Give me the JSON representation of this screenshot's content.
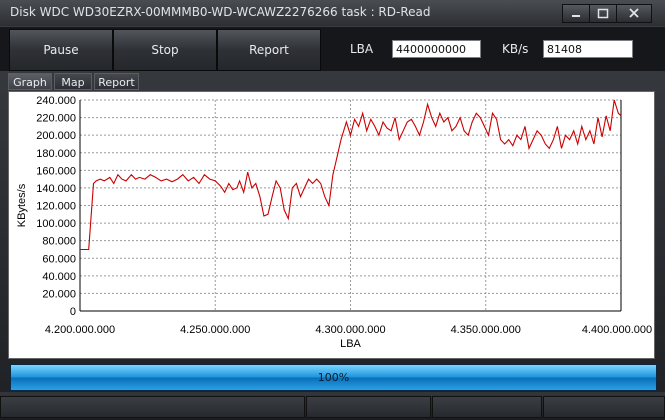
{
  "window": {
    "title": "Disk WDC WD30EZRX-00MMMB0-WD-WCAWZ2276266   task : RD-Read",
    "controls": [
      "minimize-icon",
      "maximize-icon",
      "close-icon"
    ]
  },
  "toolbar": {
    "pause_label": "Pause",
    "stop_label": "Stop",
    "report_label": "Report",
    "lba_label": "LBA",
    "lba_value": "4400000000",
    "kbs_label": "KB/s",
    "kbs_value": "81408"
  },
  "tabs": [
    {
      "label": "Graph",
      "active": true
    },
    {
      "label": "Map",
      "active": false
    },
    {
      "label": "Report",
      "active": false
    }
  ],
  "chart_data": {
    "type": "line",
    "xlabel": "LBA",
    "ylabel": "KBytes/s",
    "xlim": [
      4200000000,
      4400000000
    ],
    "ylim": [
      0,
      240000
    ],
    "grid": true,
    "x_ticks": [
      "4.200.000.000",
      "4.250.000.000",
      "4.300.000.000",
      "4.350.000.000",
      "4.400.000.000"
    ],
    "y_ticks": [
      "0",
      "20.000",
      "40.000",
      "60.000",
      "80.000",
      "100.000",
      "120.000",
      "140.000",
      "160.000",
      "180.000",
      "200.000",
      "220.000",
      "240.000"
    ],
    "line_color": "#cc0000",
    "series": [
      {
        "x": [
          4200000000,
          4202300000,
          4203200000,
          4205000000,
          4206000000,
          4207500000,
          4209000000,
          4211000000,
          4212500000,
          4214000000,
          4215500000,
          4217000000,
          4219000000,
          4220500000,
          4222000000,
          4224000000,
          4226000000,
          4228000000,
          4230000000,
          4232000000,
          4234000000,
          4236000000,
          4238000000,
          4240000000,
          4242000000,
          4244000000,
          4246000000,
          4248000000,
          4250000000,
          4252000000,
          4253500000,
          4255000000,
          4256500000,
          4258000000,
          4259000000,
          4260500000,
          4262000000,
          4263500000,
          4265000000,
          4266500000,
          4268000000,
          4269500000,
          4271000000,
          4272500000,
          4274000000,
          4275500000,
          4277000000,
          4278500000,
          4280000000,
          4281500000,
          4283000000,
          4284500000,
          4286000000,
          4287500000,
          4289000000,
          4290500000,
          4292000000,
          4293500000,
          4295000000,
          4296500000,
          4297500000,
          4298500000,
          4300000000,
          4301500000,
          4303000000,
          4304500000,
          4306000000,
          4307500000,
          4309000000,
          4310500000,
          4312000000,
          4313500000,
          4315000000,
          4316500000,
          4318000000,
          4319500000,
          4321000000,
          4322500000,
          4324000000,
          4325500000,
          4327000000,
          4328500000,
          4330000000,
          4331500000,
          4333000000,
          4334500000,
          4336000000,
          4337500000,
          4339000000,
          4340500000,
          4342000000,
          4343500000,
          4345000000,
          4346500000,
          4348000000,
          4349500000,
          4351000000,
          4352500000,
          4354000000,
          4355500000,
          4357000000,
          4358500000,
          4360000000,
          4361500000,
          4363000000,
          4364500000,
          4366000000,
          4367500000,
          4369000000,
          4370500000,
          4372000000,
          4373500000,
          4375000000,
          4376500000,
          4378000000,
          4379500000,
          4381000000,
          4382500000,
          4384000000,
          4385500000,
          4387000000,
          4388500000,
          4390000000,
          4391500000,
          4393000000,
          4394500000,
          4396000000,
          4397500000,
          4399000000,
          4400000000
        ],
        "y": [
          70000,
          70000,
          70000,
          145000,
          148000,
          150000,
          148000,
          152000,
          145000,
          155000,
          150000,
          148000,
          155000,
          150000,
          152000,
          150000,
          155000,
          152000,
          148000,
          150000,
          147000,
          150000,
          155000,
          148000,
          152000,
          145000,
          155000,
          150000,
          148000,
          142000,
          135000,
          145000,
          138000,
          140000,
          148000,
          135000,
          158000,
          140000,
          145000,
          130000,
          108000,
          110000,
          130000,
          148000,
          140000,
          115000,
          105000,
          140000,
          145000,
          130000,
          140000,
          150000,
          145000,
          150000,
          145000,
          130000,
          120000,
          155000,
          175000,
          195000,
          205000,
          215000,
          200000,
          218000,
          210000,
          225000,
          205000,
          218000,
          210000,
          200000,
          215000,
          208000,
          205000,
          220000,
          195000,
          205000,
          215000,
          218000,
          210000,
          200000,
          215000,
          235000,
          220000,
          210000,
          225000,
          215000,
          220000,
          205000,
          210000,
          220000,
          205000,
          200000,
          215000,
          225000,
          220000,
          210000,
          200000,
          225000,
          218000,
          195000,
          190000,
          195000,
          188000,
          200000,
          195000,
          210000,
          185000,
          195000,
          205000,
          200000,
          190000,
          185000,
          195000,
          210000,
          185000,
          200000,
          195000,
          205000,
          190000,
          210000,
          195000,
          205000,
          190000,
          220000,
          198000,
          222000,
          205000,
          240000,
          225000,
          222000
        ]
      }
    ]
  },
  "progress": {
    "value": 100,
    "label": "100%"
  }
}
